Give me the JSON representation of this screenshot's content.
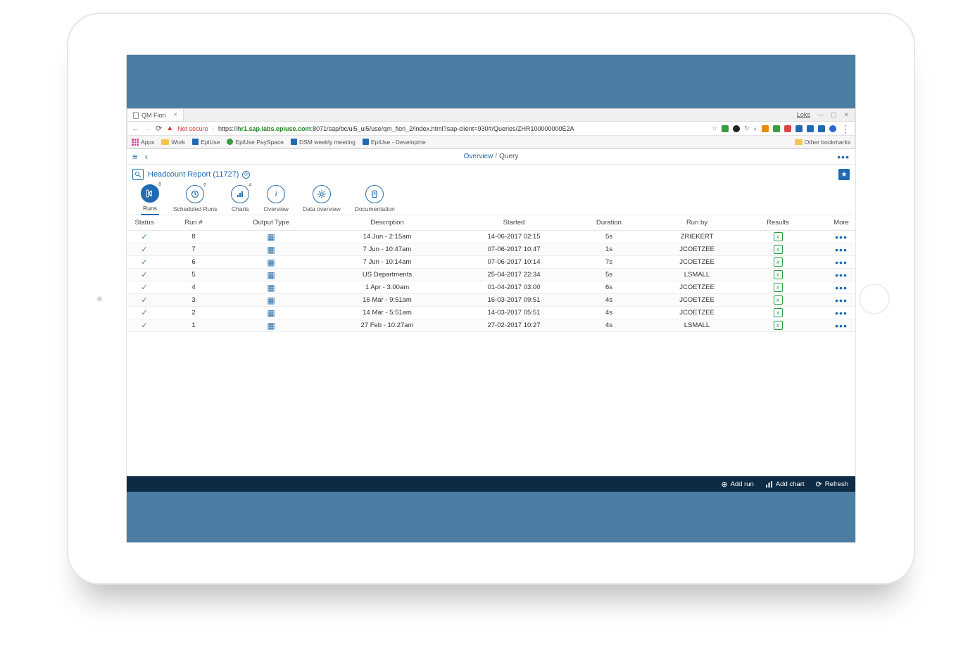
{
  "browser": {
    "tab_title": "QM Fiori",
    "window_controls": {
      "mode": "Loks",
      "min": "—",
      "max": "▢",
      "close": "✕"
    },
    "not_secure": "Not secure",
    "url_prefix": "https://",
    "url_domain": "hr1.sap.labs.epiuse.com",
    "url_path": ":8071/sap/bc/ui5_ui5/use/qm_fiori_2/index.html?sap-client=930#/Queries/ZHR100000000E2A",
    "bookmarks": [
      "Apps",
      "Work",
      "EpiUse",
      "EpiUse PaySpace",
      "DSM weekly meeting",
      "EpiUse - Developme"
    ],
    "other_bookmarks": "Other bookmarks"
  },
  "app": {
    "breadcrumb": {
      "overview": "Overview",
      "current": "Query"
    },
    "title": "Headcount Report (11727)",
    "tabs": [
      {
        "label": "Runs",
        "badge": "8"
      },
      {
        "label": "Scheduled Runs",
        "badge": "0"
      },
      {
        "label": "Charts",
        "badge": "4"
      },
      {
        "label": "Overview",
        "badge": ""
      },
      {
        "label": "Data overview",
        "badge": ""
      },
      {
        "label": "Documentation",
        "badge": ""
      }
    ],
    "columns": [
      "Status",
      "Run #",
      "Output Type",
      "Description",
      "Started",
      "Duration",
      "Run by",
      "Results",
      "More"
    ],
    "rows": [
      {
        "run": "8",
        "desc": "14 Jun - 2:15am",
        "started": "14-06-2017 02:15",
        "duration": "5s",
        "runby": "ZRIEKERT"
      },
      {
        "run": "7",
        "desc": "7 Jun - 10:47am",
        "started": "07-06-2017 10:47",
        "duration": "1s",
        "runby": "JCOETZEE"
      },
      {
        "run": "6",
        "desc": "7 Jun - 10:14am",
        "started": "07-06-2017 10:14",
        "duration": "7s",
        "runby": "JCOETZEE"
      },
      {
        "run": "5",
        "desc": "US Departments",
        "started": "25-04-2017 22:34",
        "duration": "5s",
        "runby": "LSMALL"
      },
      {
        "run": "4",
        "desc": "1 Apr - 3:00am",
        "started": "01-04-2017 03:00",
        "duration": "6s",
        "runby": "JCOETZEE"
      },
      {
        "run": "3",
        "desc": "16 Mar - 9:51am",
        "started": "16-03-2017 09:51",
        "duration": "4s",
        "runby": "JCOETZEE"
      },
      {
        "run": "2",
        "desc": "14 Mar - 5:51am",
        "started": "14-03-2017 05:51",
        "duration": "4s",
        "runby": "JCOETZEE"
      },
      {
        "run": "1",
        "desc": "27 Feb - 10:27am",
        "started": "27-02-2017 10:27",
        "duration": "4s",
        "runby": "LSMALL"
      }
    ],
    "footer": {
      "add_run": "Add run",
      "add_chart": "Add chart",
      "refresh": "Refresh"
    }
  }
}
